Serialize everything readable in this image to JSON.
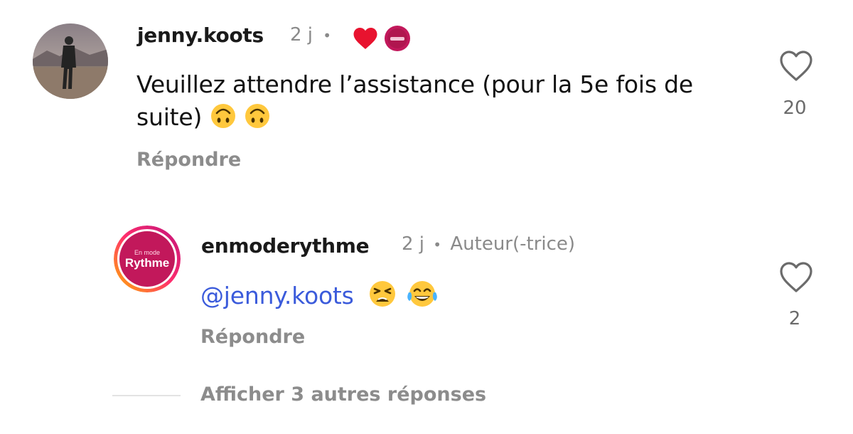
{
  "comment": {
    "username": "jenny.koots",
    "time": "2 j",
    "dot": "•",
    "body": "Veuillez attendre l’assistance (pour la 5e fois de suite)",
    "body_emoji": [
      "upside-down-face-emoji",
      "upside-down-face-emoji"
    ],
    "reply_label": "Répondre",
    "like_count": "20",
    "badges": [
      "heart-icon",
      "creator-liked-avatar"
    ]
  },
  "reply": {
    "username": "enmoderythme",
    "time": "2 j",
    "dot": "•",
    "author_label": "Auteur(-trice)",
    "avatar_text_small": "En mode",
    "avatar_text_large": "Rythme",
    "mention": "@jenny.koots",
    "body_emoji": [
      "tired-face-emoji",
      "tears-of-joy-emoji"
    ],
    "reply_label": "Répondre",
    "like_count": "2"
  },
  "view_more_label": "Afficher 3 autres réponses",
  "colors": {
    "accent_mention": "#3b5bdb",
    "heart_red": "#e8132f",
    "brand_magenta": "#c2185b"
  }
}
